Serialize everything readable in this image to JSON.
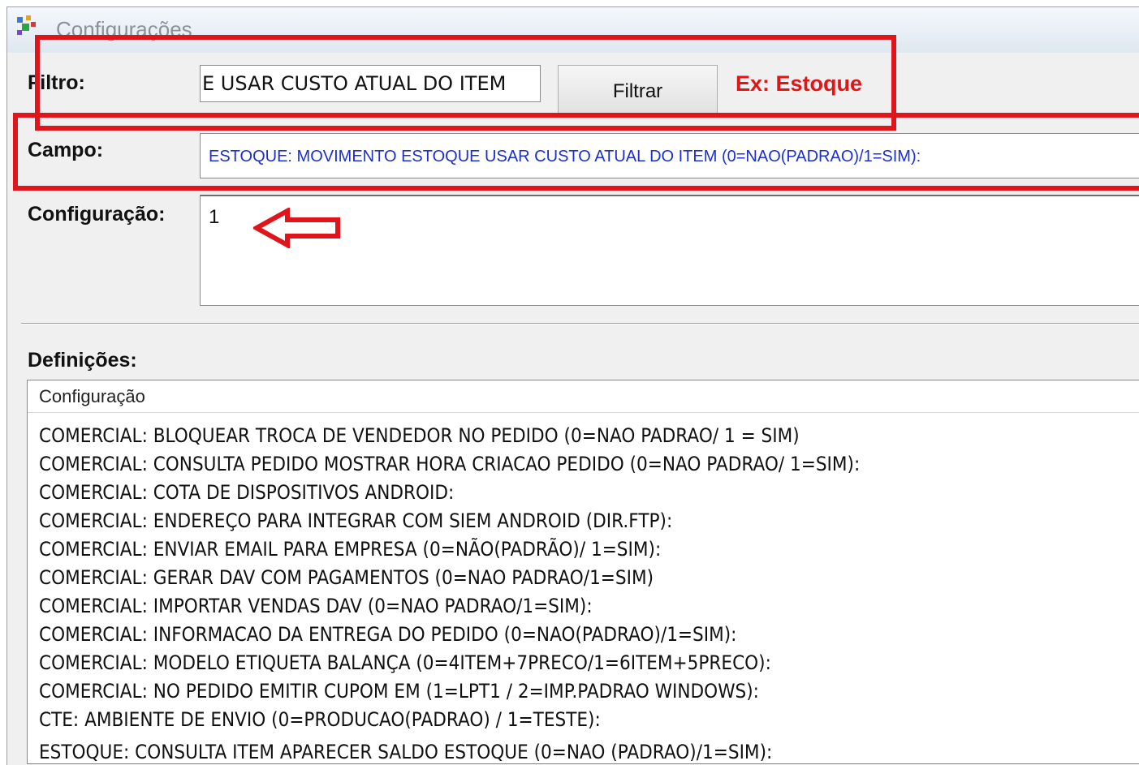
{
  "window": {
    "title": "Configurações"
  },
  "filter": {
    "label": "Filtro:",
    "value": "E USAR CUSTO ATUAL DO ITEM",
    "button_label": "Filtrar",
    "example_hint": "Ex: Estoque"
  },
  "campo": {
    "label": "Campo:",
    "value": "ESTOQUE: MOVIMENTO ESTOQUE USAR CUSTO ATUAL DO ITEM (0=NAO(PADRAO)/1=SIM):"
  },
  "configuracao": {
    "label": "Configuração:",
    "value": "1"
  },
  "definicoes": {
    "label": "Definições:",
    "column_header": "Configuração",
    "rows": [
      "COMERCIAL: BLOQUEAR TROCA DE VENDEDOR NO PEDIDO (0=NAO PADRAO/ 1 = SIM)",
      "COMERCIAL: CONSULTA PEDIDO MOSTRAR HORA CRIACAO PEDIDO (0=NAO PADRAO/ 1=SIM):",
      "COMERCIAL: COTA DE DISPOSITIVOS ANDROID:",
      "COMERCIAL: ENDEREÇO PARA INTEGRAR COM SIEM ANDROID (DIR.FTP):",
      "COMERCIAL: ENVIAR EMAIL PARA EMPRESA (0=NÃO(PADRÃO)/ 1=SIM):",
      "COMERCIAL: GERAR DAV COM PAGAMENTOS (0=NAO PADRAO/1=SIM)",
      "COMERCIAL: IMPORTAR VENDAS DAV (0=NAO PADRAO/1=SIM):",
      "COMERCIAL: INFORMACAO DA ENTREGA DO PEDIDO (0=NAO(PADRAO)/1=SIM):",
      "COMERCIAL: MODELO ETIQUETA BALANÇA (0=4ITEM+7PRECO/1=6ITEM+5PRECO):",
      "COMERCIAL: NO PEDIDO EMITIR CUPOM EM (1=LPT1 / 2=IMP.PADRAO WINDOWS):",
      "CTE: AMBIENTE DE ENVIO (0=PRODUCAO(PADRAO) / 1=TESTE):",
      "ESTOQUE: CONSULTA ITEM APARECER SALDO ESTOQUE (0=NAO (PADRAO)/1=SIM):"
    ]
  },
  "colors": {
    "highlight": "#e0141b",
    "campo_text": "#1c2fd0",
    "example_text": "#e01515"
  },
  "icons": {
    "app": "app-icon",
    "annotation": "left-arrow-icon"
  }
}
